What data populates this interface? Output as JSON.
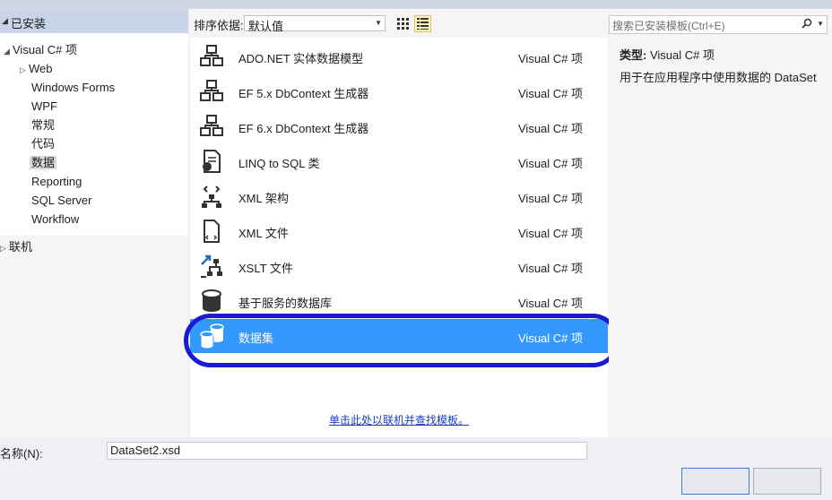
{
  "left_tree": {
    "installed_label": "已安装",
    "root_label": "Visual C# 项",
    "items": [
      "Web",
      "Windows Forms",
      "WPF",
      "常规",
      "代码",
      "数据",
      "Reporting",
      "SQL Server",
      "Workflow"
    ],
    "selected_index": 5,
    "online_label": "联机"
  },
  "sort": {
    "label": "排序依据:",
    "value": "默认值"
  },
  "templates": [
    {
      "name": "ADO.NET 实体数据模型",
      "category": "Visual C# 项",
      "icon": "entity-model-icon"
    },
    {
      "name": "EF 5.x DbContext 生成器",
      "category": "Visual C# 项",
      "icon": "dbcontext-generator-icon"
    },
    {
      "name": "EF 6.x DbContext 生成器",
      "category": "Visual C# 项",
      "icon": "dbcontext-generator-icon"
    },
    {
      "name": "LINQ to SQL 类",
      "category": "Visual C# 项",
      "icon": "linq-sql-icon"
    },
    {
      "name": "XML 架构",
      "category": "Visual C# 项",
      "icon": "xml-schema-icon"
    },
    {
      "name": "XML 文件",
      "category": "Visual C# 项",
      "icon": "xml-file-icon"
    },
    {
      "name": "XSLT 文件",
      "category": "Visual C# 项",
      "icon": "xslt-file-icon"
    },
    {
      "name": "基于服务的数据库",
      "category": "Visual C# 项",
      "icon": "database-icon"
    },
    {
      "name": "数据集",
      "category": "Visual C# 项",
      "icon": "dataset-icon"
    }
  ],
  "selected_template_index": 8,
  "online_link": "单击此处以联机并查找模板。",
  "search": {
    "placeholder": "搜索已安装模板(Ctrl+E)"
  },
  "details": {
    "type_key": "类型:",
    "type_value": "Visual C# 项",
    "description": "用于在应用程序中使用数据的 DataSet"
  },
  "name_field": {
    "label": "名称(N):",
    "value": "DataSet2.xsd"
  },
  "colors": {
    "selection": "#3399ff",
    "highlight_ring": "#1a1ad6"
  }
}
